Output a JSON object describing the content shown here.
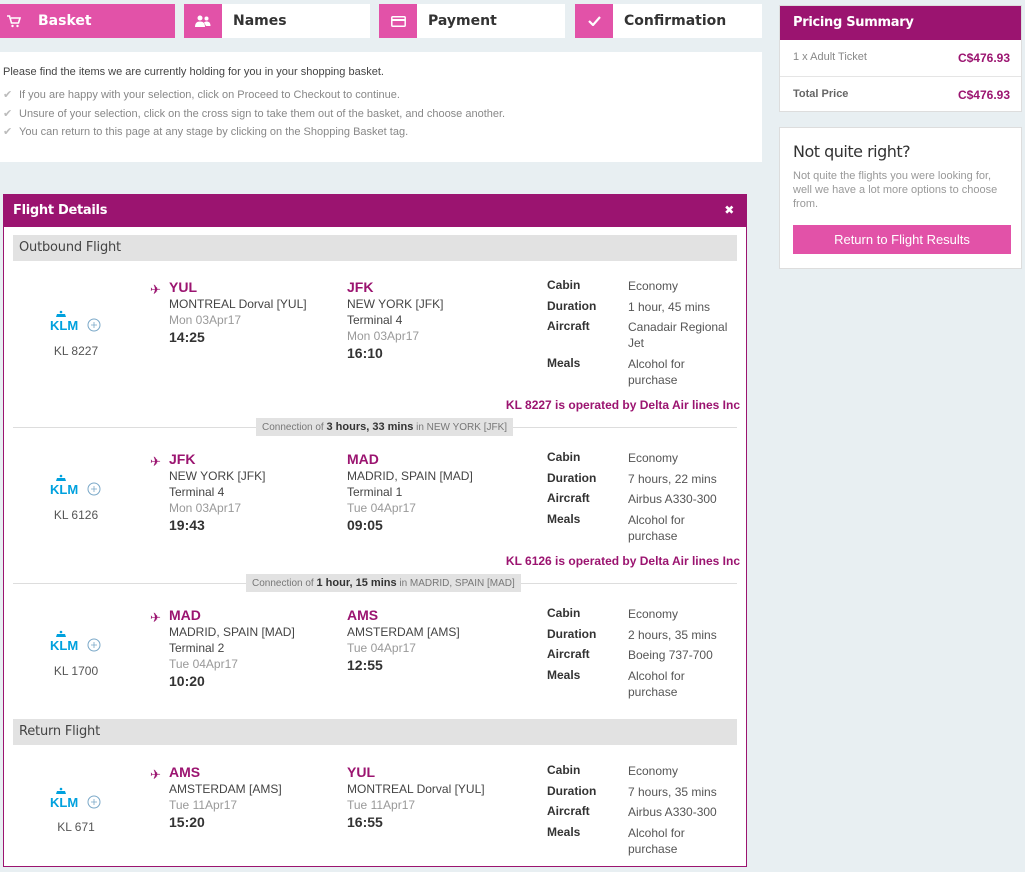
{
  "steps": [
    {
      "label": "Basket",
      "icon": "cart-icon"
    },
    {
      "label": "Names",
      "icon": "users-icon"
    },
    {
      "label": "Payment",
      "icon": "credit-card-icon"
    },
    {
      "label": "Confirmation",
      "icon": "check-icon"
    }
  ],
  "info": {
    "intro": "Please find the items we are currently holding for you in your shopping basket.",
    "tips": [
      "If you are happy with your selection, click on Proceed to Checkout to continue.",
      "Unsure of your selection, click on the cross sign to take them out of the basket, and choose another.",
      "You can return to this page at any stage by clicking on the Shopping Basket tag."
    ]
  },
  "flight_details": {
    "title": "Flight Details",
    "close": "✖",
    "outbound_label": "Outbound Flight",
    "return_label": "Return Flight",
    "labels": {
      "cabin": "Cabin",
      "duration": "Duration",
      "aircraft": "Aircraft",
      "meals": "Meals"
    },
    "segments": [
      {
        "airline": "KLM",
        "flight_no": "KL 8227",
        "from": {
          "code": "YUL",
          "city": "MONTREAL Dorval [YUL]",
          "terminal": "",
          "date": "Mon 03Apr17",
          "time": "14:25"
        },
        "to": {
          "code": "JFK",
          "city": "NEW YORK [JFK]",
          "terminal": "Terminal 4",
          "date": "Mon 03Apr17",
          "time": "16:10"
        },
        "cabin": "Economy",
        "duration": "1 hour, 45 mins",
        "aircraft": "Canadair Regional Jet",
        "meals": "Alcohol for purchase",
        "operated": "KL 8227 is operated by Delta Air lines Inc"
      },
      {
        "airline": "KLM",
        "flight_no": "KL 6126",
        "from": {
          "code": "JFK",
          "city": "NEW YORK [JFK]",
          "terminal": "Terminal 4",
          "date": "Mon 03Apr17",
          "time": "19:43"
        },
        "to": {
          "code": "MAD",
          "city": "MADRID, SPAIN [MAD]",
          "terminal": "Terminal 1",
          "date": "Tue 04Apr17",
          "time": "09:05"
        },
        "cabin": "Economy",
        "duration": "7 hours, 22 mins",
        "aircraft": "Airbus A330-300",
        "meals": "Alcohol for purchase",
        "operated": "KL 6126 is operated by Delta Air lines Inc"
      },
      {
        "airline": "KLM",
        "flight_no": "KL 1700",
        "from": {
          "code": "MAD",
          "city": "MADRID, SPAIN [MAD]",
          "terminal": "Terminal 2",
          "date": "Tue 04Apr17",
          "time": "10:20"
        },
        "to": {
          "code": "AMS",
          "city": "AMSTERDAM [AMS]",
          "terminal": "",
          "date": "Tue 04Apr17",
          "time": "12:55"
        },
        "cabin": "Economy",
        "duration": "2 hours, 35 mins",
        "aircraft": "Boeing 737-700",
        "meals": "Alcohol for purchase",
        "operated": ""
      },
      {
        "airline": "KLM",
        "flight_no": "KL 671",
        "from": {
          "code": "AMS",
          "city": "AMSTERDAM [AMS]",
          "terminal": "",
          "date": "Tue 11Apr17",
          "time": "15:20"
        },
        "to": {
          "code": "YUL",
          "city": "MONTREAL Dorval [YUL]",
          "terminal": "",
          "date": "Tue 11Apr17",
          "time": "16:55"
        },
        "cabin": "Economy",
        "duration": "7 hours, 35 mins",
        "aircraft": "Airbus A330-300",
        "meals": "Alcohol for purchase",
        "operated": ""
      }
    ],
    "connections": [
      {
        "prefix": "Connection of",
        "duration": "3 hours, 33 mins",
        "suffix": "in NEW YORK [JFK]"
      },
      {
        "prefix": "Connection of",
        "duration": "1 hour, 15 mins",
        "suffix": "in MADRID, SPAIN [MAD]"
      }
    ]
  },
  "pricing": {
    "title": "Pricing Summary",
    "rows": [
      {
        "label": "1 x Adult Ticket",
        "amount": "C$476.93"
      },
      {
        "label": "Total Price",
        "amount": "C$476.93"
      }
    ]
  },
  "not_quite_right": {
    "title": "Not quite right?",
    "text": "Not quite the flights you were looking for, well we have a lot more options to choose from.",
    "button": "Return to Flight Results"
  },
  "colors": {
    "brand": "#9b1470",
    "accent": "#e252a8"
  }
}
